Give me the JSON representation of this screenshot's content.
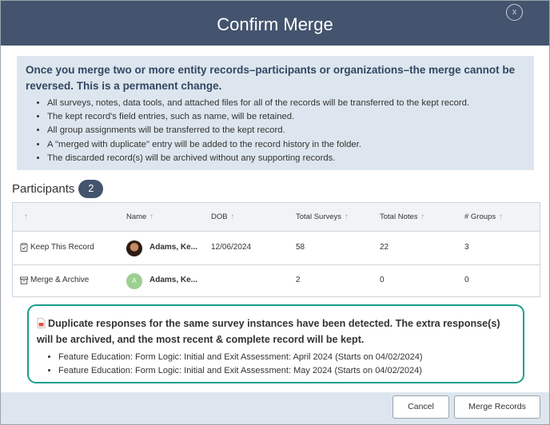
{
  "dialog": {
    "title": "Confirm Merge",
    "close_label": "x"
  },
  "warning": {
    "headline": "Once you merge two or more entity records–participants or organizations–the merge cannot be reversed. This is a permanent change.",
    "bullets": [
      "All surveys, notes, data tools, and attached files for all of the records will be transferred to the kept record.",
      "The kept record's field entries, such as name, will be retained.",
      "All group assignments will be transferred to the kept record.",
      "A \"merged with duplicate\" entry will be added to the record history in the folder.",
      "The discarded record(s) will be archived without any supporting records."
    ]
  },
  "participants": {
    "label": "Participants",
    "count": "2"
  },
  "table": {
    "sort_arrow": "↑",
    "columns": {
      "name": "Name",
      "dob": "DOB",
      "total_surveys": "Total Surveys",
      "total_notes": "Total Notes",
      "groups": "# Groups"
    },
    "rows": [
      {
        "action": "Keep This Record",
        "action_icon": "clipboard-check-icon",
        "avatar": "photo",
        "name": "Adams, Ke...",
        "dob": "12/06/2024",
        "total_surveys": "58",
        "total_notes": "22",
        "groups": "3"
      },
      {
        "action": "Merge & Archive",
        "action_icon": "archive-box-icon",
        "avatar": "initial",
        "avatar_initial": "A",
        "name": "Adams, Ke...",
        "dob": "",
        "total_surveys": "2",
        "total_notes": "0",
        "groups": "0"
      }
    ]
  },
  "duplicates": {
    "icon": "document-warning-icon",
    "message": "Duplicate responses for the same survey instances have been detected. The extra response(s) will be archived, and the most recent & complete record will be kept.",
    "items": [
      "Feature Education: Form Logic: Initial and Exit Assessment: April 2024 (Starts on 04/02/2024)",
      "Feature Education: Form Logic: Initial and Exit Assessment: May 2024 (Starts on 04/02/2024)"
    ]
  },
  "footer": {
    "cancel_label": "Cancel",
    "merge_label": "Merge Records"
  },
  "colors": {
    "header": "#44546e",
    "panel": "#dde6ee",
    "accent": "#1aa08a",
    "heading_text": "#324763"
  }
}
